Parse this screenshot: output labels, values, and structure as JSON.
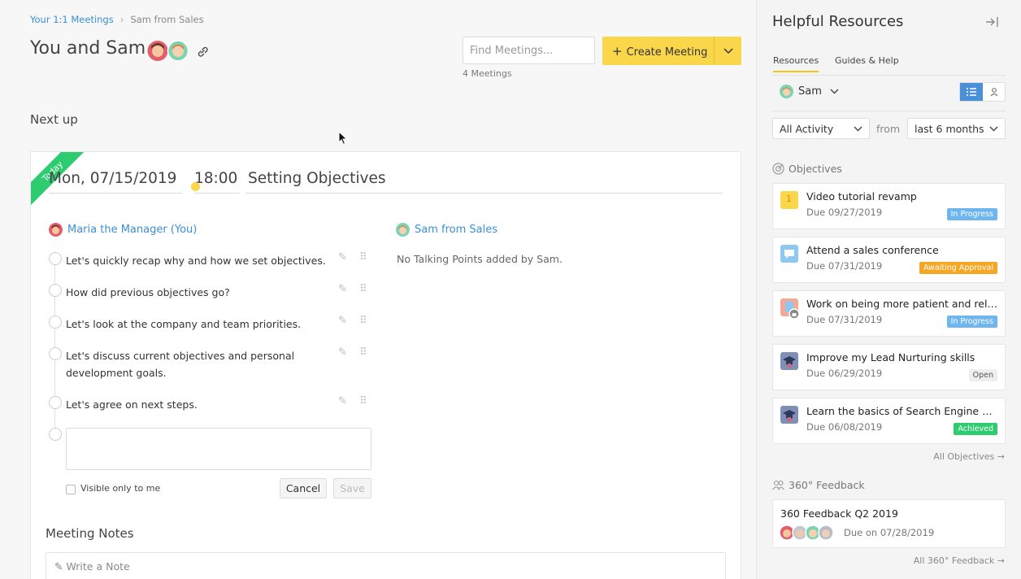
{
  "breadcrumb": {
    "parent": "Your 1:1 Meetings",
    "current": "Sam from Sales"
  },
  "header": {
    "title": "You and Sam",
    "search_placeholder": "Find Meetings...",
    "create_label": "Create Meeting",
    "meeting_count": "4 Meetings"
  },
  "next_up": "Next up",
  "meeting": {
    "badge": "Today",
    "date": "Mon, 07/15/2019",
    "time": "18:00",
    "title": "Setting Objectives",
    "manager": {
      "name": "Maria the Manager (You)"
    },
    "report": {
      "name": "Sam from Sales",
      "empty": "No Talking Points added by Sam."
    },
    "talking_points": [
      "Let's quickly recap why and how we set objectives.",
      "How did previous objectives go?",
      "Let's look at the company and team priorities.",
      "Let's discuss current objectives and personal development goals.",
      "Let's agree on next steps."
    ],
    "visible_label": "Visible only to me",
    "cancel_label": "Cancel",
    "save_label": "Save",
    "notes_heading": "Meeting Notes",
    "notes_placeholder": "Write a Note"
  },
  "sidebar": {
    "title": "Helpful Resources",
    "tabs": [
      "Resources",
      "Guides & Help"
    ],
    "person": "Sam",
    "filter_activity": "All Activity",
    "from_label": "from",
    "filter_period": "last 6 months",
    "objectives_heading": "Objectives",
    "objectives": [
      {
        "title": "Video tutorial revamp",
        "due": "Due 09/27/2019",
        "status": "In Progress",
        "icon": "number-one-icon",
        "icon_color": "#f9d64a"
      },
      {
        "title": "Attend a sales conference",
        "due": "Due 07/31/2019",
        "status": "Awaiting Approval",
        "icon": "speech-bubble-icon",
        "icon_color": "#8cc8f2"
      },
      {
        "title": "Work on being more patient and rela...",
        "due": "Due 07/31/2019",
        "status": "In Progress",
        "icon": "locked-objective-icon",
        "icon_color": "#f4a898"
      },
      {
        "title": "Improve my Lead Nurturing skills",
        "due": "Due 06/29/2019",
        "status": "Open",
        "icon": "graduation-cap-icon",
        "icon_color": "#7f8fb6"
      },
      {
        "title": "Learn the basics of Search Engine O...",
        "due": "Due 06/08/2019",
        "status": "Achieved",
        "icon": "graduation-cap-icon",
        "icon_color": "#7f8fb6"
      }
    ],
    "all_objectives": "All Objectives",
    "feedback_heading": "360° Feedback",
    "feedback": {
      "title": "360 Feedback Q2 2019",
      "due": "Due on 07/28/2019"
    },
    "all_feedback": "All 360° Feedback"
  },
  "colors": {
    "accent_yellow": "#f9d64a",
    "link_blue": "#3a8fd6",
    "today_green": "#2ecc71",
    "status_in_progress": "#6fb6ee",
    "status_awaiting": "#f5a623",
    "status_achieved": "#2ecc71",
    "status_open": "#eeeeee"
  }
}
